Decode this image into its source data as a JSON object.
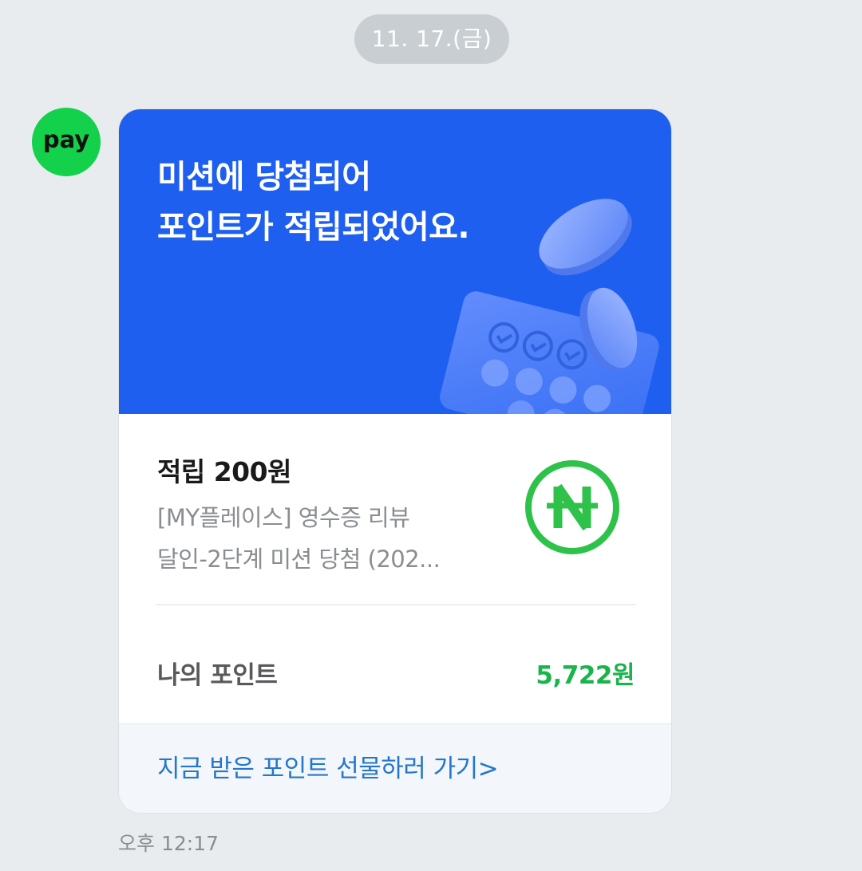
{
  "chat": {
    "date": "11. 17.(금)",
    "time": "오후 12:17"
  },
  "sender": {
    "avatar_text": "pay",
    "avatar_color": "#14d14c"
  },
  "card": {
    "banner_title": "미션에 당첨되어\n포인트가 적립되었어요.",
    "banner_color": "#1f5ff0",
    "earn_text": "적립 200원",
    "description_line1": "[MY플레이스] 영수증 리뷰",
    "description_line2": "달인-2단계 미션 당첨 (202...",
    "logo_icon": "naver-pay-point-icon",
    "my_point_label": "나의 포인트",
    "my_point_value": "5,722원",
    "point_color": "#19b44b",
    "footer_link": "지금 받은 포인트 선물하러 가기>",
    "link_color": "#2477c9"
  }
}
